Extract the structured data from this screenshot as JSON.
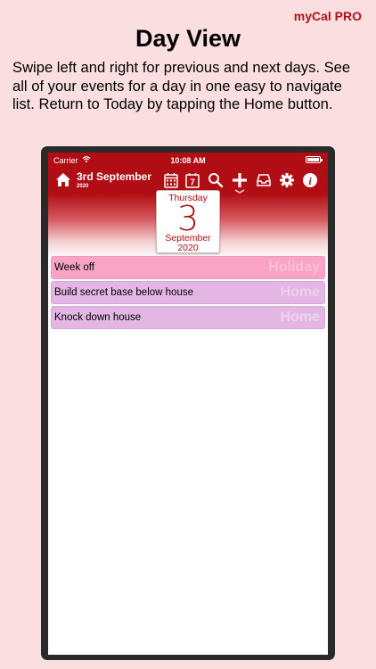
{
  "brand": "myCal PRO",
  "headline": "Day View",
  "blurb": "Swipe left and right for previous and next days. See all of your events for a day in one easy to navigate list. Return to Today by tapping the Home button.",
  "status": {
    "carrier": "Carrier",
    "time": "10:08 AM"
  },
  "header": {
    "date_label": "3rd September",
    "year_label": "2020"
  },
  "datecard": {
    "weekday": "Thursday",
    "day": "3",
    "month": "September",
    "year": "2020"
  },
  "events": [
    {
      "title": "Week off",
      "category": "Holiday"
    },
    {
      "title": "Build secret base below house",
      "category": "Home"
    },
    {
      "title": "Knock down house",
      "category": "Home"
    }
  ],
  "colors": {
    "accent": "#b00d14",
    "background": "#fbdfe0",
    "holiday": "#f9a3c5",
    "home": "#e3b6e4"
  },
  "icons": [
    "home-icon",
    "month-calendar-icon",
    "week-calendar-icon",
    "search-icon",
    "add-icon",
    "inbox-icon",
    "gear-icon",
    "info-icon"
  ]
}
